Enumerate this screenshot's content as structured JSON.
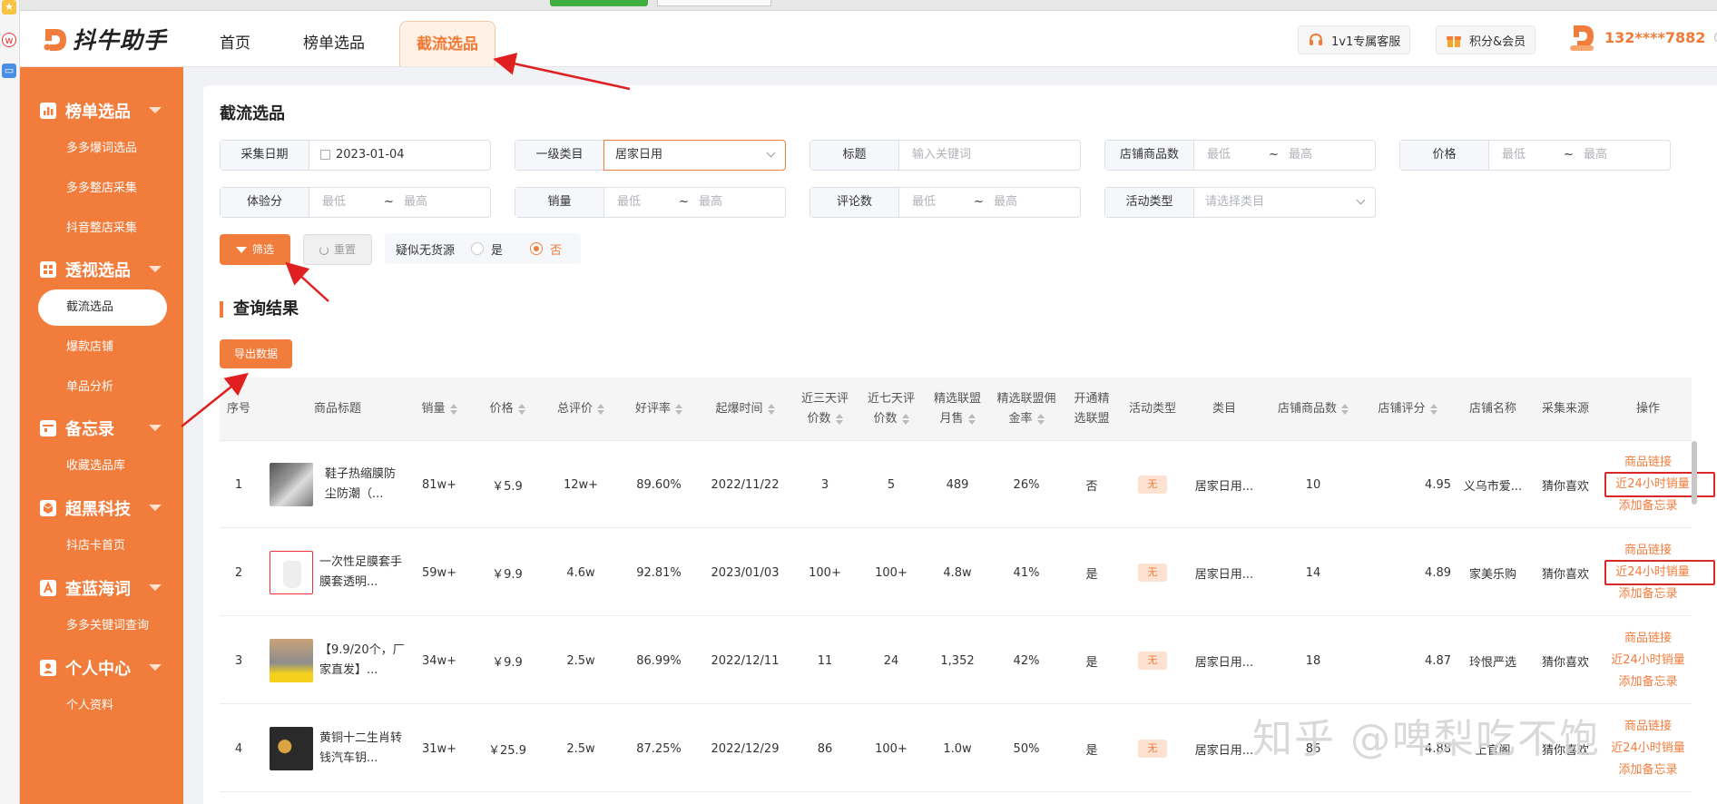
{
  "app": {
    "logo_text": "抖牛助手",
    "nav_tabs": [
      "首页",
      "榜单选品",
      "截流选品"
    ],
    "support_label": "1v1专属客服",
    "points_label": "积分&会员",
    "user_phone": "132****7882"
  },
  "sidebar": {
    "groups": [
      {
        "label": "榜单选品",
        "items": [
          "多多爆词选品",
          "多多整店采集",
          "抖音整店采集"
        ]
      },
      {
        "label": "透视选品",
        "items": [
          "截流选品",
          "爆款店铺",
          "单品分析"
        ]
      },
      {
        "label": "备忘录",
        "items": [
          "收藏选品库"
        ]
      },
      {
        "label": "超黑科技",
        "items": [
          "抖店卡首页"
        ]
      },
      {
        "label": "查蓝海词",
        "items": [
          "多多关键词查询"
        ]
      },
      {
        "label": "个人中心",
        "items": [
          "个人资料"
        ]
      }
    ],
    "active_item": "截流选品"
  },
  "filters": {
    "title": "截流选品",
    "date": {
      "label": "采集日期",
      "value": "2023-01-04"
    },
    "category": {
      "label": "一级类目",
      "value": "居家日用"
    },
    "keyword": {
      "label": "标题",
      "placeholder": "输入关键词"
    },
    "store_goods": {
      "label": "店铺商品数",
      "min": "最低",
      "sep": "~",
      "max": "最高"
    },
    "price": {
      "label": "价格",
      "min": "最低",
      "sep": "~",
      "max": "最高"
    },
    "experience": {
      "label": "体验分",
      "min": "最低",
      "sep": "~",
      "max": "最高"
    },
    "sales": {
      "label": "销量",
      "min": "最低",
      "sep": "~",
      "max": "最高"
    },
    "reviews": {
      "label": "评论数",
      "min": "最低",
      "sep": "~",
      "max": "最高"
    },
    "activity": {
      "label": "活动类型",
      "placeholder": "请选择类目"
    },
    "filter_btn": "筛选",
    "reset_btn": "重置",
    "no_source": {
      "label": "疑似无货源",
      "yes": "是",
      "no": "否",
      "selected": "否"
    }
  },
  "results": {
    "title": "查询结果",
    "export_btn": "导出数据",
    "columns": {
      "idx": "序号",
      "title": "商品标题",
      "sales": "销量",
      "price": "价格",
      "total_reviews": "总评价",
      "good_rate": "好评率",
      "hot_time": "起爆时间",
      "r3_a": "近三天评",
      "r3_b": "价数",
      "r7_a": "近七天评",
      "r7_b": "价数",
      "mon_a": "精选联盟",
      "mon_b": "月售",
      "comm_a": "精选联盟佣",
      "comm_b": "金率",
      "open_a": "开通精",
      "open_b": "选联盟",
      "activity": "活动类型",
      "category": "类目",
      "store_goods": "店铺商品数",
      "store_score": "店铺评分",
      "store_name": "店铺名称",
      "source": "采集来源",
      "ops": "操作"
    },
    "op_labels": {
      "link": "商品链接",
      "sales24": "近24小时销量",
      "memo": "添加备忘录"
    },
    "rows": [
      {
        "idx": "1",
        "title": "鞋子热缩膜防尘防潮（...",
        "sales": "81w+",
        "price": "￥5.9",
        "reviews": "12w+",
        "good_rate": "89.60%",
        "hot_time": "2022/11/22",
        "r3": "3",
        "r7": "5",
        "monthly": "489",
        "commission": "26%",
        "open": "否",
        "activity": "无",
        "category": "居家日用...",
        "store_goods": "10",
        "store_score": "4.95",
        "store_name": "义乌市爱...",
        "source": "猜你喜欢"
      },
      {
        "idx": "2",
        "title": "一次性足膜套手膜套透明...",
        "sales": "59w+",
        "price": "￥9.9",
        "reviews": "4.6w",
        "good_rate": "92.81%",
        "hot_time": "2023/01/03",
        "r3": "100+",
        "r7": "100+",
        "monthly": "4.8w",
        "commission": "41%",
        "open": "是",
        "activity": "无",
        "category": "居家日用...",
        "store_goods": "14",
        "store_score": "4.89",
        "store_name": "家美乐购",
        "source": "猜你喜欢"
      },
      {
        "idx": "3",
        "title": "【9.9/20个，厂家直发】...",
        "sales": "34w+",
        "price": "￥9.9",
        "reviews": "2.5w",
        "good_rate": "86.99%",
        "hot_time": "2022/12/11",
        "r3": "11",
        "r7": "24",
        "monthly": "1,352",
        "commission": "42%",
        "open": "是",
        "activity": "无",
        "category": "居家日用...",
        "store_goods": "18",
        "store_score": "4.87",
        "store_name": "玲恨严选",
        "source": "猜你喜欢"
      },
      {
        "idx": "4",
        "title": "黄铜十二生肖转钱汽车钥...",
        "sales": "31w+",
        "price": "￥25.9",
        "reviews": "2.5w",
        "good_rate": "87.25%",
        "hot_time": "2022/12/29",
        "r3": "86",
        "r7": "100+",
        "monthly": "1.0w",
        "commission": "50%",
        "open": "是",
        "activity": "无",
        "category": "居家日用...",
        "store_goods": "86",
        "store_score": "4.88",
        "store_name": "上官阁",
        "source": "猜你喜欢"
      }
    ]
  },
  "watermark": "知乎 @啤梨吃不饱",
  "colors": {
    "accent": "#f27c3b",
    "highlight_box": "#d82828",
    "arrow": "#e02020"
  }
}
